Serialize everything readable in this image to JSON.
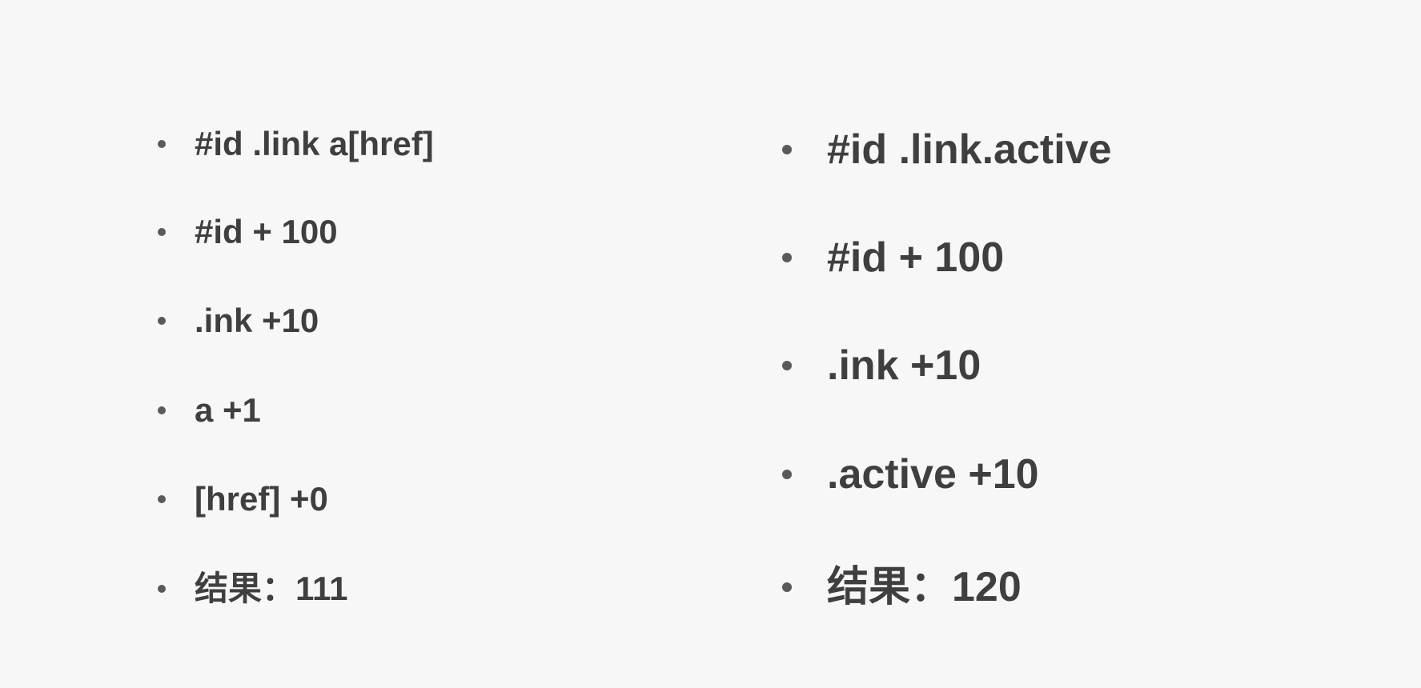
{
  "left_column": {
    "items": [
      "#id .link a[href]",
      "#id + 100",
      ".ink +10",
      "a +1",
      "[href] +0",
      "结果：111"
    ]
  },
  "right_column": {
    "items": [
      "#id .link.active",
      "#id + 100",
      ".ink +10",
      ".active +10",
      "结果：120"
    ]
  },
  "colors": {
    "background": "#f7f7f7",
    "text": "#3f3f3f",
    "bullet": "#5a5a5a"
  }
}
